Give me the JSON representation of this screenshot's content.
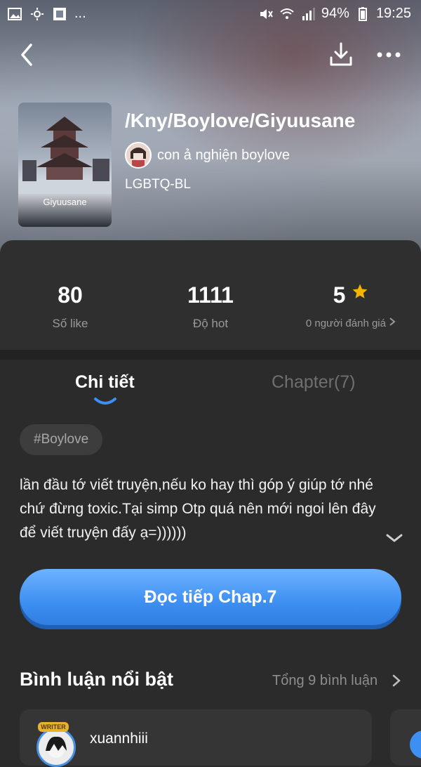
{
  "status_bar": {
    "battery": "94%",
    "time": "19:25",
    "more": "..."
  },
  "story": {
    "title": "/Kny/Boylove/Giyuusane",
    "author": "con ả nghiện boylove",
    "category": "LGBTQ-BL",
    "cover_label": "Giyuusane"
  },
  "stats": {
    "likes": {
      "value": "80",
      "label": "Số like"
    },
    "hot": {
      "value": "1111",
      "label": "Độ hot"
    },
    "rating": {
      "value": "5",
      "label": "0 người đánh giá"
    }
  },
  "tabs": {
    "detail": "Chi tiết",
    "chapters": "Chapter(7)"
  },
  "hashtag": "#Boylove",
  "description": "lần đầu tớ viết truyện,nếu ko hay thì góp ý giúp tớ nhé chứ đừng toxic.Tại simp Otp quá nên mới ngoi lên đây để viết truyện đấy ạ=))))))",
  "read_button": "Đọc tiếp Chap.7",
  "comments": {
    "title": "Bình luận nổi bật",
    "total": "Tổng 9 bình luận",
    "first": {
      "badge": "WRITER",
      "name": "xuannhiii"
    }
  },
  "colors": {
    "accent": "#3d8ff2",
    "star": "#f5b400",
    "background": "#2b2b2b"
  }
}
